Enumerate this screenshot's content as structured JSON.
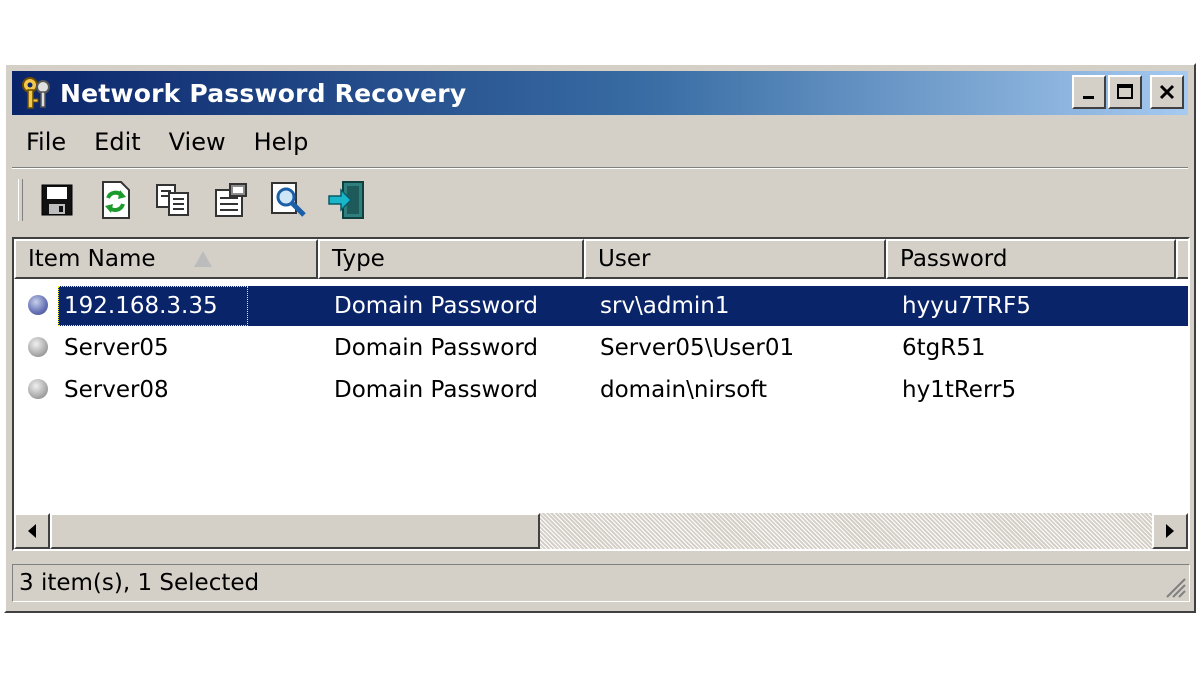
{
  "window": {
    "title": "Network Password Recovery"
  },
  "menu": [
    {
      "label": "File"
    },
    {
      "label": "Edit"
    },
    {
      "label": "View"
    },
    {
      "label": "Help"
    }
  ],
  "toolbar": [
    {
      "icon": "save-icon"
    },
    {
      "icon": "refresh-icon"
    },
    {
      "icon": "copy-icon"
    },
    {
      "icon": "properties-icon"
    },
    {
      "icon": "find-icon"
    },
    {
      "icon": "exit-icon"
    }
  ],
  "table": {
    "columns": [
      "Item Name",
      "Type",
      "User",
      "Password"
    ],
    "sorted_column": "Item Name",
    "rows": [
      {
        "item_name": "192.168.3.35",
        "type": "Domain Password",
        "user": "srv\\admin1",
        "password": "hyyu7TRF5",
        "selected": true,
        "bullet": "blue"
      },
      {
        "item_name": "Server05",
        "type": "Domain Password",
        "user": "Server05\\User01",
        "password": "6tgR51",
        "selected": false,
        "bullet": "gray"
      },
      {
        "item_name": "Server08",
        "type": "Domain Password",
        "user": "domain\\nirsoft",
        "password": "hy1tRerr5",
        "selected": false,
        "bullet": "gray"
      }
    ]
  },
  "statusbar": {
    "text": "3 item(s), 1 Selected"
  },
  "colors": {
    "title_gradient_start": "#0a246a",
    "title_gradient_end": "#a6caf0",
    "selection": "#0a246a",
    "face": "#d4d0c8"
  }
}
